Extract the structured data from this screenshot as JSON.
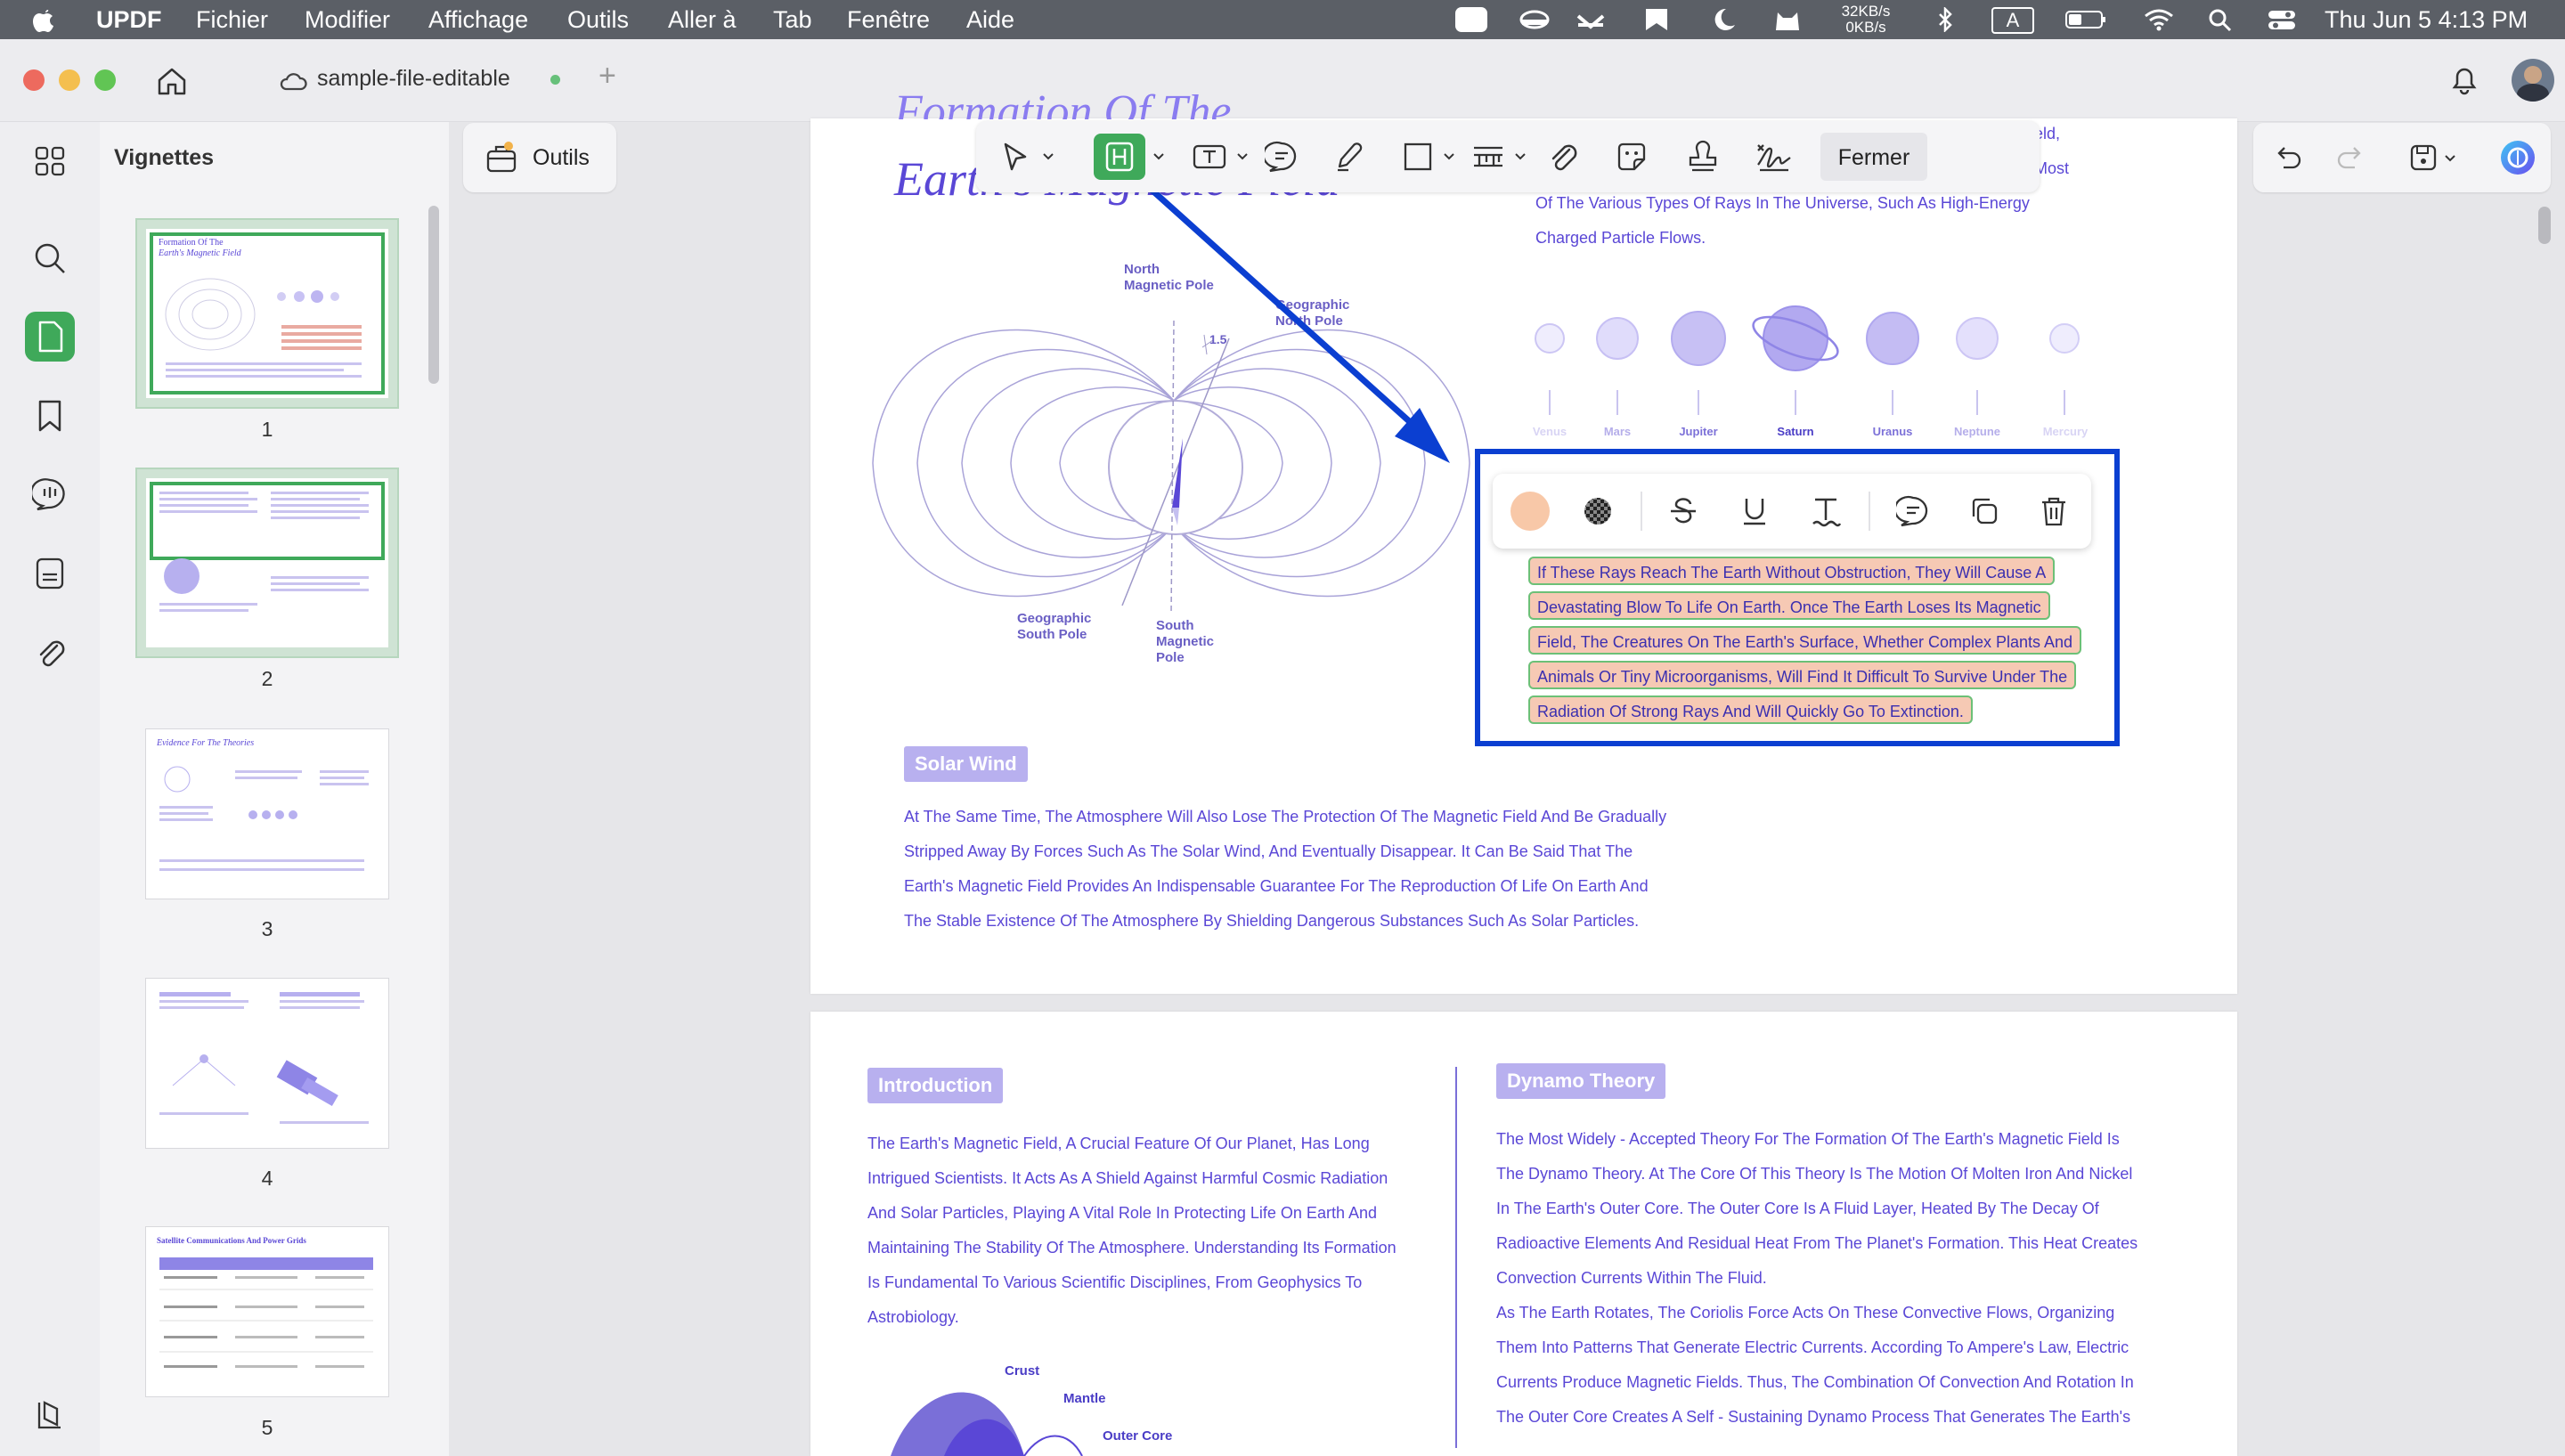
{
  "menubar": {
    "app_name": "UPDF",
    "items": [
      "Fichier",
      "Modifier",
      "Affichage",
      "Outils",
      "Aller à",
      "Tab",
      "Fenêtre",
      "Aide"
    ],
    "net_up": "32KB/s",
    "net_down": "0KB/s",
    "input_source": "A",
    "datetime": "Thu Jun 5  4:13 PM"
  },
  "titlebar": {
    "tab_title": "sample-file-editable",
    "new_tab": "+"
  },
  "sidebar": {
    "panel_title": "Vignettes",
    "thumbnails": [
      {
        "num": "1",
        "heading": "Formation Of The",
        "subheading": "Earth's Magnetic Field"
      },
      {
        "num": "2",
        "heading": "",
        "subheading": ""
      },
      {
        "num": "3",
        "heading": "Evidence For The Theories",
        "subheading": ""
      },
      {
        "num": "4",
        "heading": "",
        "subheading": ""
      },
      {
        "num": "5",
        "heading": "Satellite Communications And Power Grids",
        "subheading": ""
      }
    ]
  },
  "toolbar": {
    "outils_label": "Outils",
    "fermer_label": "Fermer"
  },
  "page1": {
    "title_top": "Formation Of The",
    "title_main": "Earth's Magnetic Field",
    "top_right_lines": [
      "eld,",
      "Most",
      "Of The Various Types Of Rays In The Universe, Such As High-Energy",
      "Charged Particle Flows."
    ],
    "diagram_labels": {
      "north": "North\nMagnetic Pole",
      "geo_north": "Geographic\nNorth Pole",
      "angle": "1.5",
      "geo_south": "Geographic\nSouth Pole",
      "south": "South\nMagnetic\nPole"
    },
    "planets": [
      "Venus",
      "Mars",
      "Jupiter",
      "Saturn",
      "Uranus",
      "Neptune",
      "Mercury"
    ],
    "highlight_lines": [
      "If These Rays Reach The Earth Without Obstruction, They Will Cause A",
      "Devastating Blow To Life On Earth. Once The Earth Loses Its Magnetic",
      "Field, The Creatures On The Earth's Surface, Whether Complex Plants And",
      "Animals Or Tiny Microorganisms, Will Find It Difficult To Survive Under The",
      "Radiation Of Strong Rays And Will Quickly Go To Extinction."
    ],
    "solar_wind_tag": "Solar Wind",
    "solar_wind_lines": [
      "At The Same Time, The Atmosphere Will Also Lose The Protection Of The Magnetic Field And Be Gradually",
      "Stripped Away By Forces Such As The Solar Wind, And Eventually Disappear. It Can Be Said That The",
      "Earth's Magnetic Field Provides An Indispensable Guarantee For The Reproduction Of Life On Earth And",
      "The Stable Existence Of The Atmosphere By Shielding Dangerous Substances Such As Solar Particles."
    ]
  },
  "page2": {
    "intro_tag": "Introduction",
    "intro_lines": [
      "The Earth's Magnetic Field, A Crucial Feature Of Our Planet, Has Long",
      "Intrigued Scientists. It Acts As A Shield Against Harmful Cosmic Radiation",
      "And Solar Particles, Playing A Vital Role In Protecting Life On Earth And",
      "Maintaining The Stability Of The Atmosphere. Understanding Its Formation",
      "Is Fundamental To Various Scientific Disciplines, From Geophysics To",
      "Astrobiology."
    ],
    "dynamo_tag": "Dynamo Theory",
    "dynamo_lines": [
      "The Most Widely - Accepted Theory For The Formation Of The Earth's Magnetic Field Is",
      "The Dynamo Theory. At The Core Of This Theory Is The Motion Of Molten Iron And Nickel",
      "In The Earth's Outer Core. The Outer Core Is A Fluid Layer, Heated By The Decay Of",
      "Radioactive Elements And Residual Heat From The Planet's Formation. This Heat Creates",
      "Convection Currents Within The Fluid.",
      "As The Earth Rotates, The Coriolis Force Acts On These Convective Flows, Organizing",
      "Them Into Patterns That Generate Electric Currents. According To Ampere's Law, Electric",
      "Currents Produce Magnetic Fields. Thus, The Combination Of Convection And Rotation In",
      "The Outer Core Creates A Self - Sustaining Dynamo Process That Generates The Earth's"
    ],
    "layer_labels": [
      "Crust",
      "Mantle",
      "Outer Core"
    ]
  },
  "colors": {
    "accent_green": "#3fa95a",
    "annotation_blue": "#0b3fd1",
    "doc_purple": "#5a47d6",
    "highlight": "#f6c9b4"
  }
}
